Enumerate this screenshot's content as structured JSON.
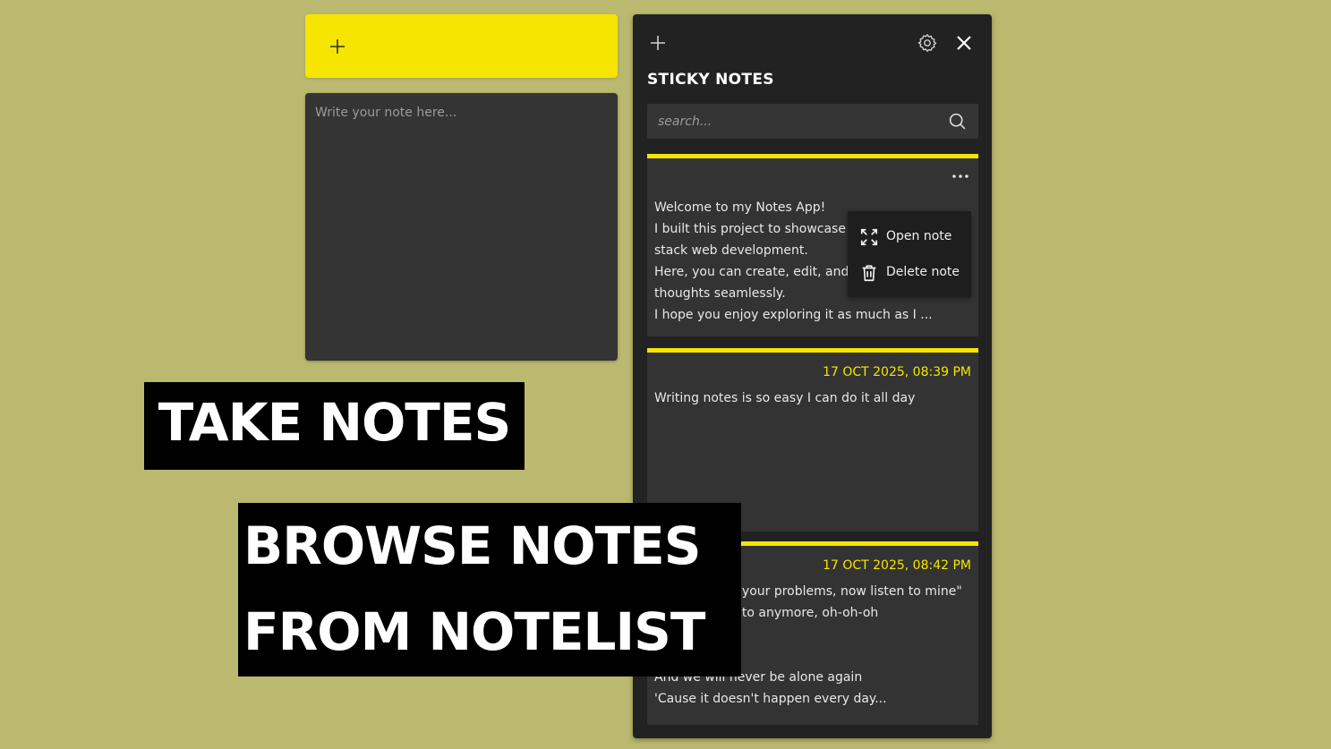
{
  "editor": {
    "add_icon": "plus-icon",
    "placeholder": "Write your note here...",
    "accent": "#f5e500"
  },
  "panel": {
    "title": "STICKY NOTES",
    "add_icon": "plus-icon",
    "settings_icon": "gear-icon",
    "close_icon": "close-icon",
    "search_placeholder": "search...",
    "search_icon": "search-icon"
  },
  "notes": [
    {
      "date": "",
      "text": "Welcome to my Notes App!\nI built this project to showcase\nstack web development.\nHere, you can create, edit, and\nthoughts seamlessly.\nI hope you enjoy exploring it as much as I ..."
    },
    {
      "date": "17 OCT 2025, 08:39 PM",
      "text": "Writing notes is so easy I can do it all day"
    },
    {
      "date": "17 OCT 2025, 08:42 PM",
      "text": "                      your problems, now listen to mine\"\n                      to anymore, oh-oh-oh\n\n\nAnd we will never be alone again\n'Cause it doesn't happen every day..."
    }
  ],
  "context_menu": {
    "open_label": "Open note",
    "open_icon": "expand-icon",
    "delete_label": "Delete note",
    "delete_icon": "trash-icon"
  },
  "captions": {
    "take_notes": "TAKE NOTES",
    "browse_line1": "BROWSE NOTES",
    "browse_line2": "FROM NOTELIST"
  },
  "colors": {
    "background": "#bbb96f",
    "accent_yellow": "#f5e500",
    "panel": "#222222",
    "card": "#333333"
  }
}
